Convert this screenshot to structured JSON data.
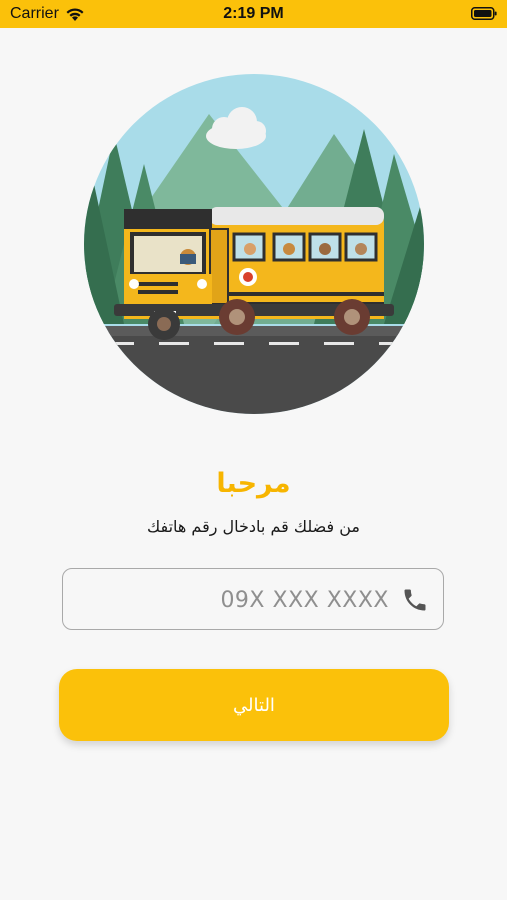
{
  "status_bar": {
    "carrier": "Carrier",
    "time": "2:19 PM"
  },
  "welcome": {
    "title": "مرحبا",
    "subtitle": "من فضلك قم بادخال رقم هاتفك"
  },
  "phone_field": {
    "value": "",
    "placeholder": "09X XXX XXXX",
    "icon": "phone-icon"
  },
  "next_button": {
    "label": "التالي"
  },
  "colors": {
    "accent": "#fbc10a",
    "title": "#f7b500",
    "background": "#f7f7f7"
  }
}
